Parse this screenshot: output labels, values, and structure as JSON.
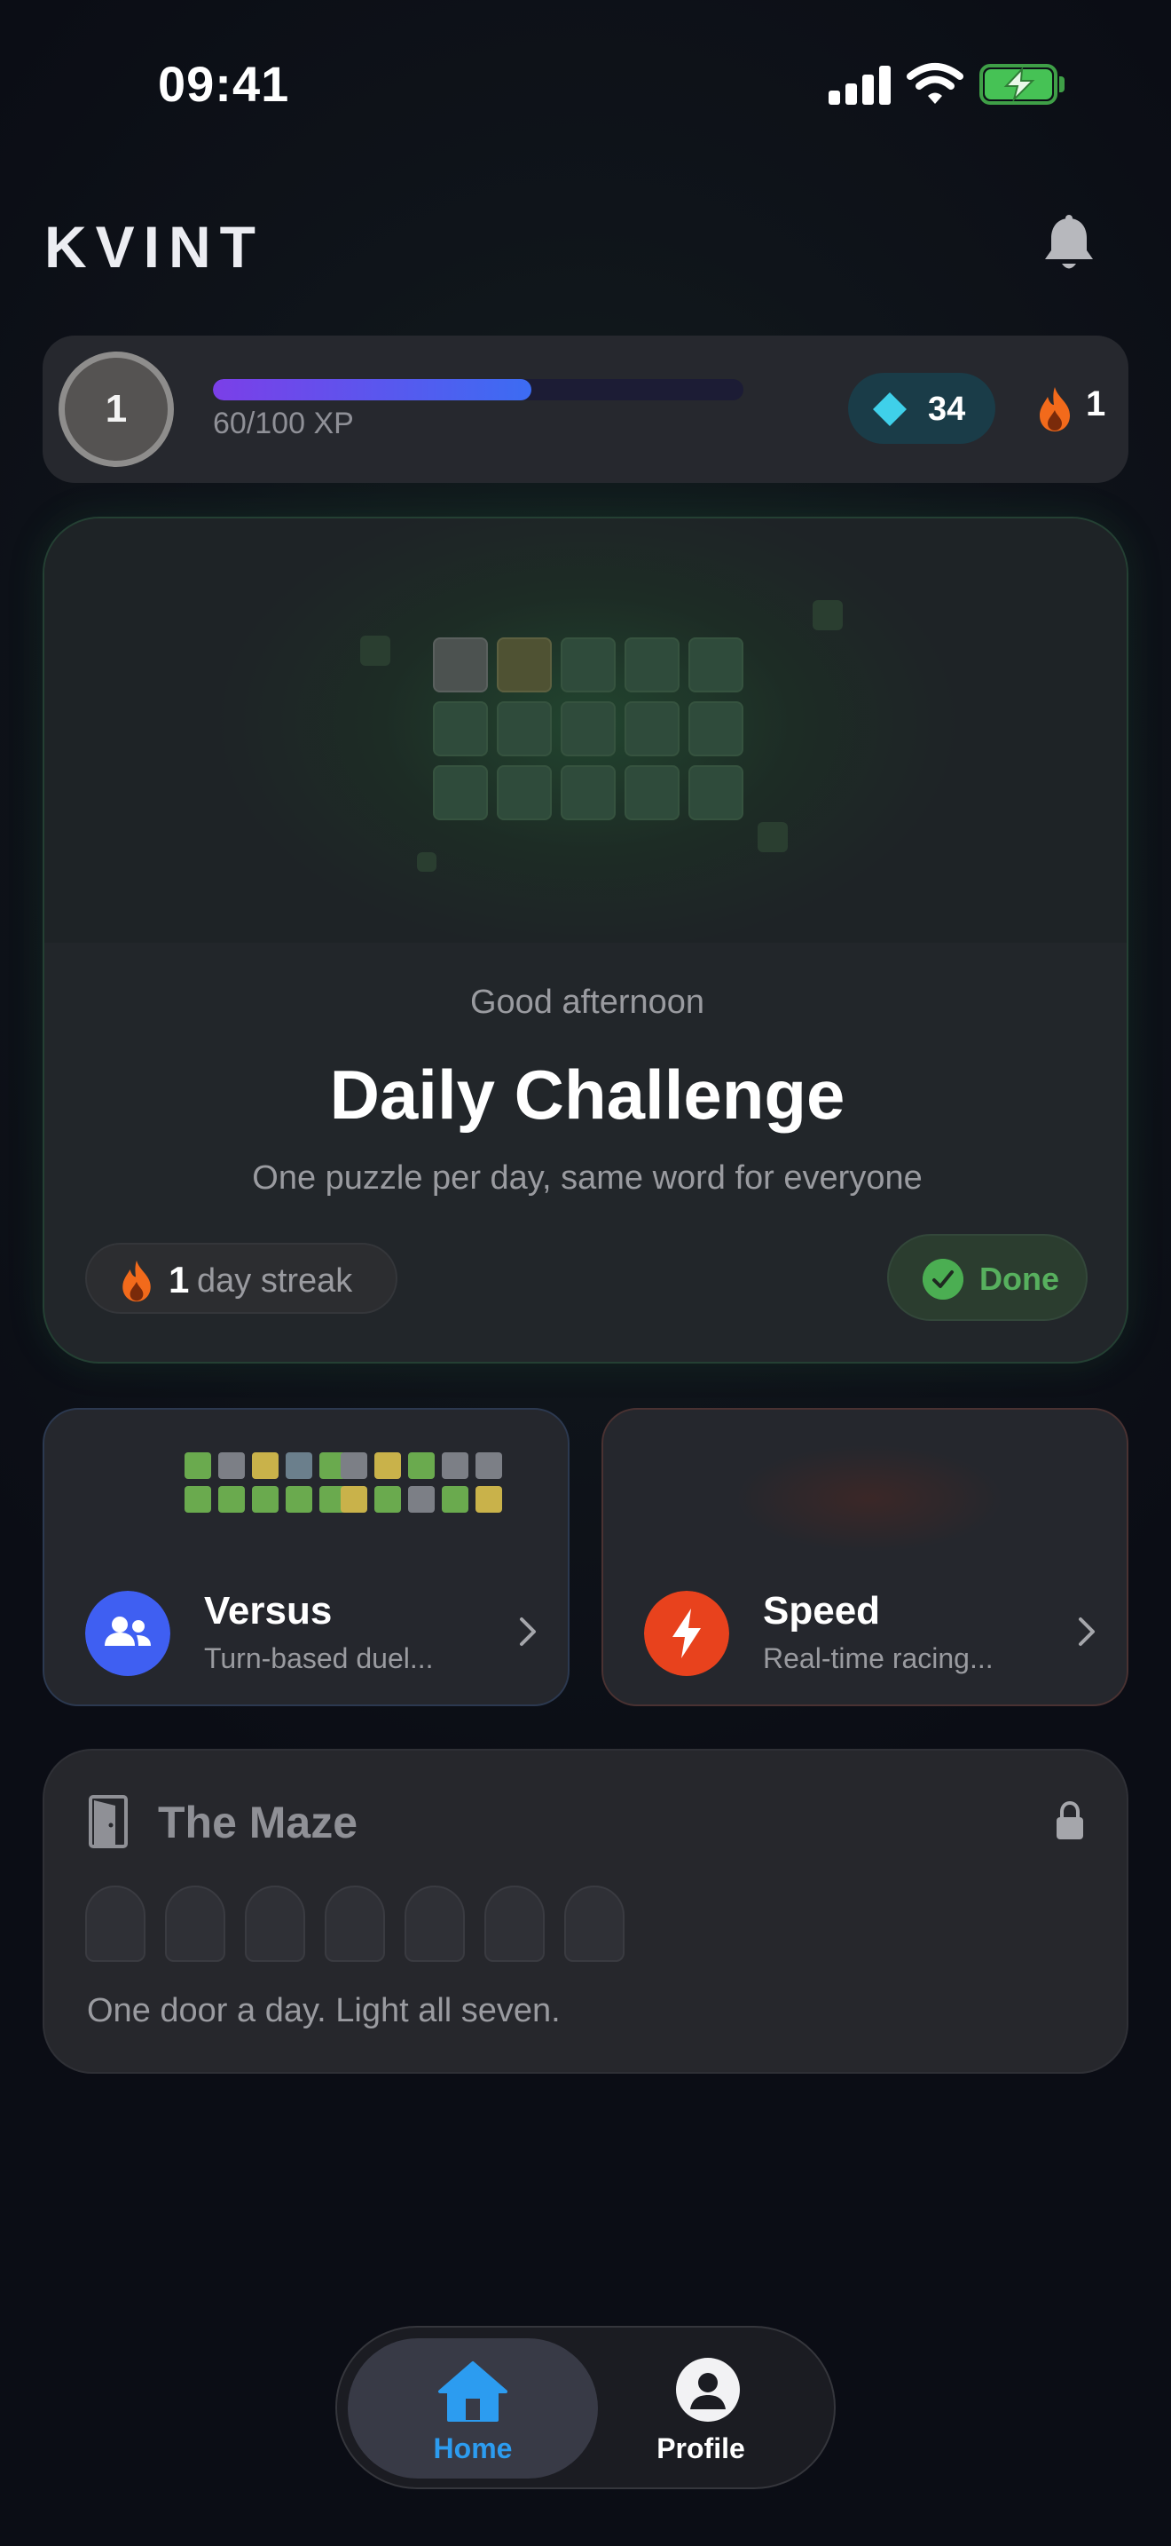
{
  "status_bar": {
    "time": "09:41",
    "battery_state": "charging"
  },
  "header": {
    "logo": "KVINT",
    "notification_icon": "bell-icon"
  },
  "progress": {
    "level": "1",
    "xp_label": "60/100 XP",
    "xp_fraction": 0.6,
    "gems": "34",
    "streak": "1",
    "colors": {
      "xp_start": "#7b3fe8",
      "xp_end": "#3c6cf3",
      "gem": "#3fd0ea",
      "flame": "#f26a1b"
    }
  },
  "daily": {
    "greeting": "Good afternoon",
    "title": "Daily Challenge",
    "subtitle": "One puzzle per day, same word for everyone",
    "streak_number": "1",
    "streak_text": "day streak",
    "done_label": "Done",
    "accent": "#4bae52"
  },
  "modes": [
    {
      "title": "Versus",
      "subtitle": "Turn-based duel...",
      "icon": "users-icon",
      "color": "#3f5ff2"
    },
    {
      "title": "Speed",
      "subtitle": "Real-time racing...",
      "icon": "bolt-icon",
      "color": "#e8421d"
    }
  ],
  "maze": {
    "title": "The Maze",
    "subtitle": "One door a day. Light all seven.",
    "doors_total": 7,
    "doors_lit": 0,
    "locked": true
  },
  "nav": {
    "items": [
      {
        "label": "Home",
        "icon": "home-icon",
        "active": true
      },
      {
        "label": "Profile",
        "icon": "profile-icon",
        "active": false
      }
    ],
    "active_color": "#2c9cf0"
  }
}
